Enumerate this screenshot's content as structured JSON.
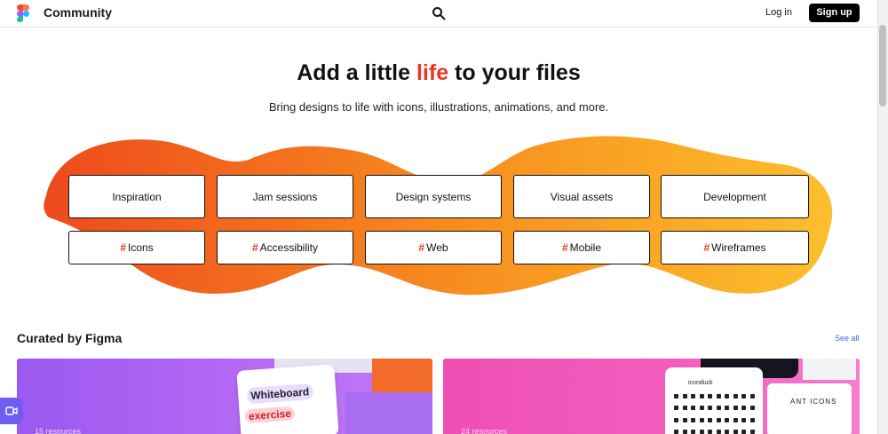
{
  "header": {
    "brand": "Community",
    "login_label": "Log in",
    "signup_label": "Sign up"
  },
  "hero": {
    "title_before": "Add a little ",
    "title_accent": "life",
    "title_after": " to your files",
    "subtitle": "Bring designs to life with icons, illustrations, animations, and more."
  },
  "categories": [
    "Inspiration",
    "Jam sessions",
    "Design systems",
    "Visual assets",
    "Development"
  ],
  "tags": [
    "Icons",
    "Accessibility",
    "Web",
    "Mobile",
    "Wireframes"
  ],
  "tag_symbol": "#",
  "curated": {
    "title": "Curated by Figma",
    "see_all": "See all",
    "cards": [
      {
        "count": "15 resources",
        "labels": [
          "Whiteboard",
          "exercise"
        ]
      },
      {
        "count": "24 resources",
        "brand": "iconduck",
        "label": "ANT ICONS"
      }
    ]
  },
  "colors": {
    "accent": "#e6371f",
    "blob_start": "#ee4a1d",
    "blob_end": "#fcbf2d",
    "link": "#2f6fdc"
  }
}
